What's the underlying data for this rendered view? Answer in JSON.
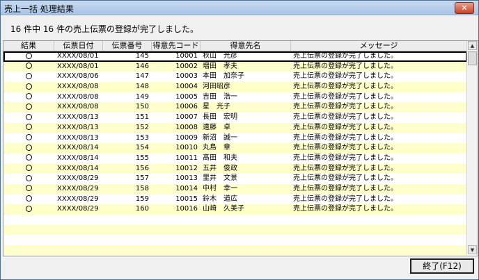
{
  "window": {
    "title": "売上一括 処理結果",
    "close_label": "✕"
  },
  "summary": "16 件中 16 件の売上伝票の登録が完了しました。",
  "table": {
    "headers": [
      "結果",
      "伝票日付",
      "伝票番号",
      "得意先コード",
      "得意先名",
      "メッセージ"
    ],
    "rows": [
      {
        "date": "XXXX/08/01",
        "no": "145",
        "code": "10001",
        "name": "秋山　光彦",
        "msg": "売上伝票の登録が完了しました。"
      },
      {
        "date": "XXXX/08/01",
        "no": "146",
        "code": "10002",
        "name": "増田　孝夫",
        "msg": "売上伝票の登録が完了しました。"
      },
      {
        "date": "XXXX/08/06",
        "no": "147",
        "code": "10003",
        "name": "本田　加奈子",
        "msg": "売上伝票の登録が完了しました。"
      },
      {
        "date": "XXXX/08/08",
        "no": "148",
        "code": "10004",
        "name": "河田昭彦",
        "msg": "売上伝票の登録が完了しました。"
      },
      {
        "date": "XXXX/08/08",
        "no": "149",
        "code": "10005",
        "name": "吉田　浩一",
        "msg": "売上伝票の登録が完了しました。"
      },
      {
        "date": "XXXX/08/08",
        "no": "150",
        "code": "10006",
        "name": "星　光子",
        "msg": "売上伝票の登録が完了しました。"
      },
      {
        "date": "XXXX/08/13",
        "no": "151",
        "code": "10007",
        "name": "長田　宏明",
        "msg": "売上伝票の登録が完了しました。"
      },
      {
        "date": "XXXX/08/13",
        "no": "152",
        "code": "10008",
        "name": "遠藤　卓",
        "msg": "売上伝票の登録が完了しました。"
      },
      {
        "date": "XXXX/08/13",
        "no": "153",
        "code": "10009",
        "name": "新沼　誠一",
        "msg": "売上伝票の登録が完了しました。"
      },
      {
        "date": "XXXX/08/14",
        "no": "154",
        "code": "10010",
        "name": "丸島　章",
        "msg": "売上伝票の登録が完了しました。"
      },
      {
        "date": "XXXX/08/14",
        "no": "155",
        "code": "10011",
        "name": "高田　和夫",
        "msg": "売上伝票の登録が完了しました。"
      },
      {
        "date": "XXXX/08/14",
        "no": "156",
        "code": "10012",
        "name": "五井　俊政",
        "msg": "売上伝票の登録が完了しました。"
      },
      {
        "date": "XXXX/08/29",
        "no": "157",
        "code": "10013",
        "name": "里井　文景",
        "msg": "売上伝票の登録が完了しました。"
      },
      {
        "date": "XXXX/08/29",
        "no": "158",
        "code": "10014",
        "name": "中村　幸一",
        "msg": "売上伝票の登録が完了しました。"
      },
      {
        "date": "XXXX/08/29",
        "no": "159",
        "code": "10015",
        "name": "鈴木　道広",
        "msg": "売上伝票の登録が完了しました。"
      },
      {
        "date": "XXXX/08/29",
        "no": "160",
        "code": "10016",
        "name": "山崎　久美子",
        "msg": "売上伝票の登録が完了しました。"
      }
    ],
    "result_icon": "circle-icon",
    "empty_rows": 4
  },
  "scrollbar": {
    "up": "▲",
    "down": "▼"
  },
  "footer": {
    "finish_label": "終了(F12)"
  },
  "colors": {
    "alt_row": "#ffffcc",
    "titlebar": "#b8cfeb"
  }
}
